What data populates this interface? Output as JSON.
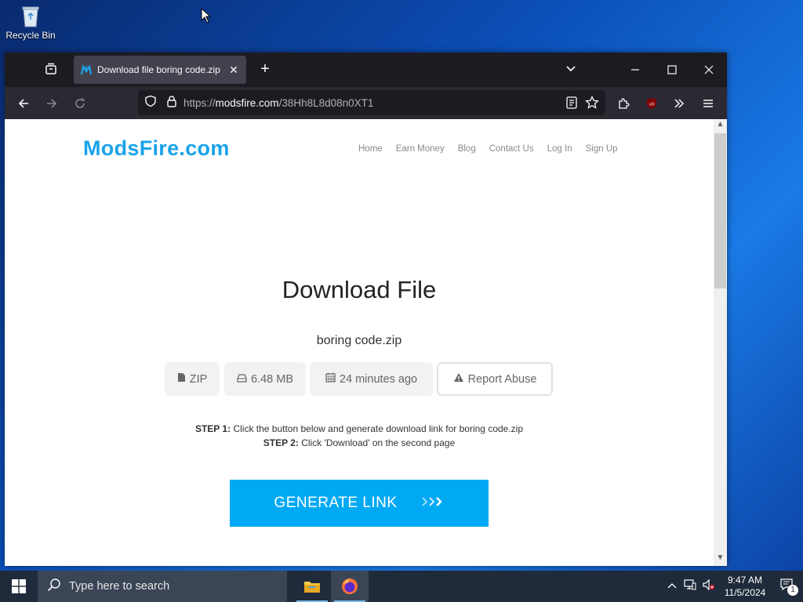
{
  "desktop": {
    "recycle_bin_label": "Recycle Bin"
  },
  "browser": {
    "tab_title": "Download file boring code.zip",
    "url_prefix": "https://",
    "url_domain": "modsfire.com",
    "url_path": "/38Hh8L8d08n0XT1"
  },
  "site": {
    "logo_text": "ModsFire.com",
    "nav": [
      "Home",
      "Earn Money",
      "Blog",
      "Contact Us",
      "Log In",
      "Sign Up"
    ],
    "heading": "Download File",
    "filename": "boring code.zip",
    "meta": {
      "type": "ZIP",
      "size": "6.48 MB",
      "uploaded": "24 minutes ago",
      "report": "Report Abuse"
    },
    "step1_label": "STEP 1:",
    "step1_text": " Click the button below and generate download link for boring code.zip",
    "step2_label": "STEP 2:",
    "step2_text": " Click 'Download' on the second page",
    "generate_button": "GENERATE LINK"
  },
  "taskbar": {
    "search_placeholder": "Type here to search",
    "time": "9:47 AM",
    "date": "11/5/2024",
    "notification_count": "1"
  },
  "colors": {
    "brand": "#1aa3ea",
    "button": "#00a9f4"
  }
}
